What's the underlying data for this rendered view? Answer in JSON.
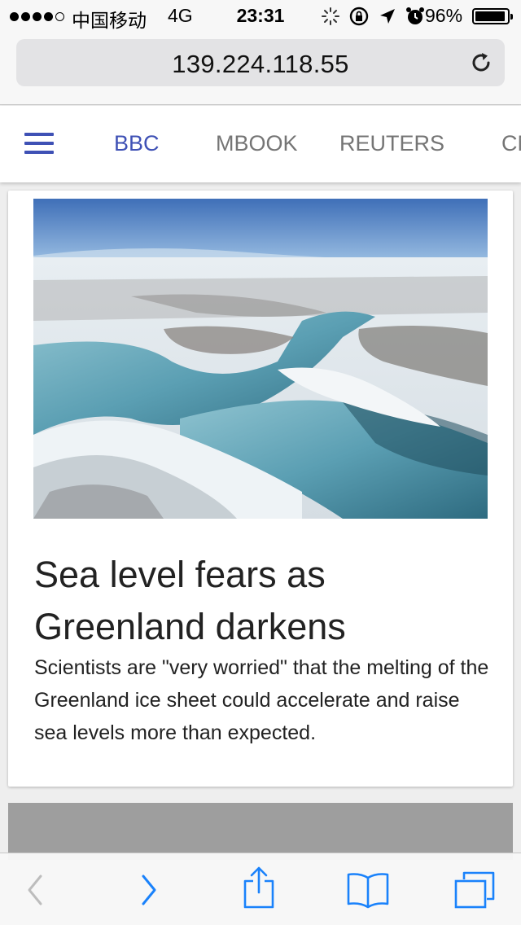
{
  "status_bar": {
    "carrier": "中国移动",
    "network": "4G",
    "time": "23:31",
    "battery_percent": "96%",
    "battery_level": 0.96,
    "signal_bars_filled": 4,
    "signal_bars_total": 5,
    "icons": [
      "activity-spinner-icon",
      "rotation-lock-icon",
      "location-arrow-icon",
      "alarm-icon",
      "battery-icon"
    ]
  },
  "browser": {
    "url": "139.224.118.55",
    "reload_icon": "reload-icon"
  },
  "nav": {
    "menu_icon": "hamburger-menu-icon",
    "tabs": [
      {
        "label": "BBC",
        "active": true
      },
      {
        "label": "MBOOK",
        "active": false
      },
      {
        "label": "REUTERS",
        "active": false
      },
      {
        "label": "CN",
        "active": false
      }
    ],
    "accent_color": "#3f51b5",
    "inactive_color": "#757575"
  },
  "article": {
    "image_alt": "greenland-meltwater-river-photo",
    "title": "Sea level fears as Greenland darkens",
    "summary": "Scientists are \"very worried\" that the melting of the Greenland ice sheet could accelerate and raise sea levels more than expected."
  },
  "toolbar": {
    "buttons": [
      {
        "name": "back",
        "icon": "chevron-left-icon",
        "enabled": false
      },
      {
        "name": "forward",
        "icon": "chevron-right-icon",
        "enabled": true
      },
      {
        "name": "share",
        "icon": "share-icon",
        "enabled": true
      },
      {
        "name": "bookmarks",
        "icon": "book-icon",
        "enabled": true
      },
      {
        "name": "tabs",
        "icon": "tabs-icon",
        "enabled": true
      }
    ],
    "tint_color": "#1a82fb",
    "disabled_color": "#bdbdbd"
  }
}
